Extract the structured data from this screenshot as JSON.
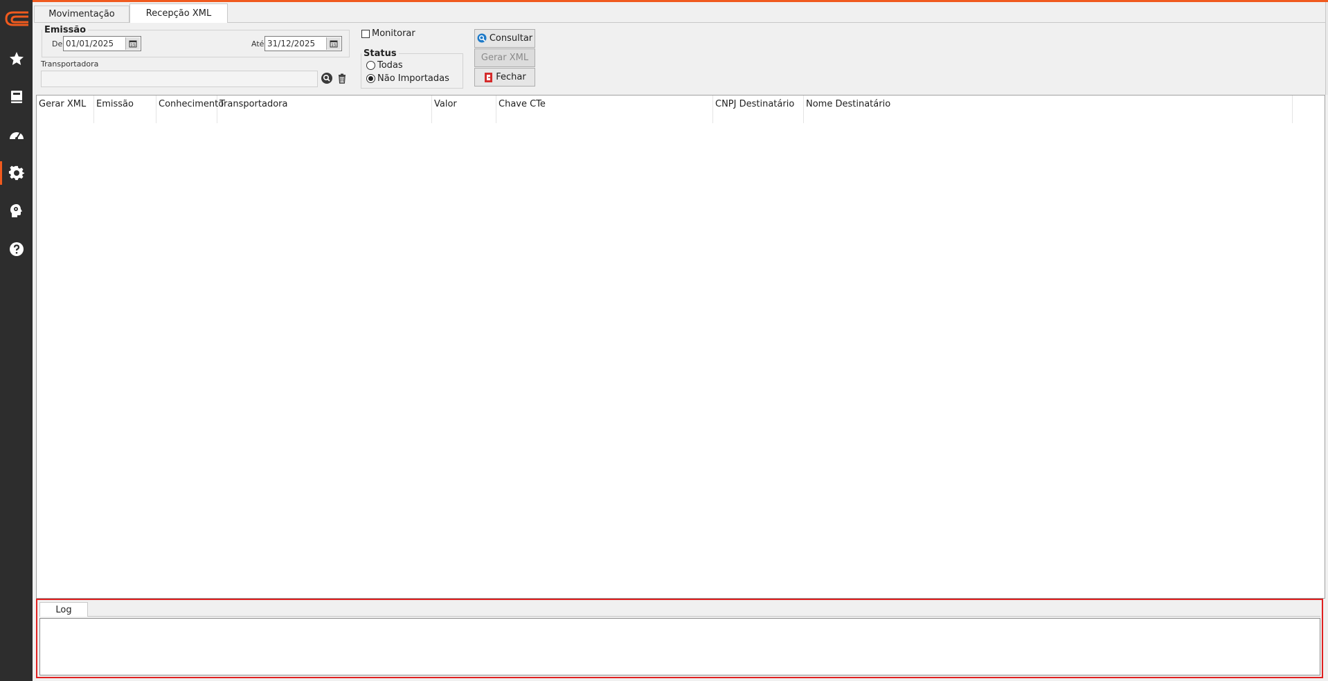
{
  "app": {
    "accent": "#f05a1e",
    "sidebar_bg": "#2d2d2d"
  },
  "sidebar": {
    "items": [
      {
        "icon": "star-icon",
        "active": false
      },
      {
        "icon": "book-icon",
        "active": false
      },
      {
        "icon": "dashboard-gauge-icon",
        "active": false
      },
      {
        "icon": "gear-icon",
        "active": true
      },
      {
        "icon": "head-gear-icon",
        "active": false
      },
      {
        "icon": "help-icon",
        "active": false
      }
    ]
  },
  "tabs": [
    {
      "label": "Movimentação",
      "active": false
    },
    {
      "label": "Recepção XML",
      "active": true
    }
  ],
  "filters": {
    "emissao": {
      "legend": "Emissão",
      "de_label": "De",
      "de_value": "01/01/2025",
      "ate_label": "Até",
      "ate_value": "31/12/2025"
    },
    "transportadora": {
      "label": "Transportadora",
      "value": ""
    },
    "monitorar": {
      "label": "Monitorar",
      "checked": false
    },
    "status": {
      "legend": "Status",
      "options": [
        {
          "label": "Todas",
          "selected": false
        },
        {
          "label": "Não Importadas",
          "selected": true
        }
      ]
    }
  },
  "buttons": {
    "consultar": {
      "label": "Consultar",
      "enabled": true
    },
    "gerar_xml": {
      "label": "Gerar XML",
      "enabled": false
    },
    "fechar": {
      "label": "Fechar",
      "enabled": true
    }
  },
  "grid": {
    "columns": [
      "Gerar XML",
      "Emissão",
      "Conhecimento",
      "Transportadora",
      "Valor",
      "Chave CTe",
      "CNPJ Destinatário",
      "Nome Destinatário"
    ],
    "rows": []
  },
  "log": {
    "tab_label": "Log",
    "content": ""
  }
}
